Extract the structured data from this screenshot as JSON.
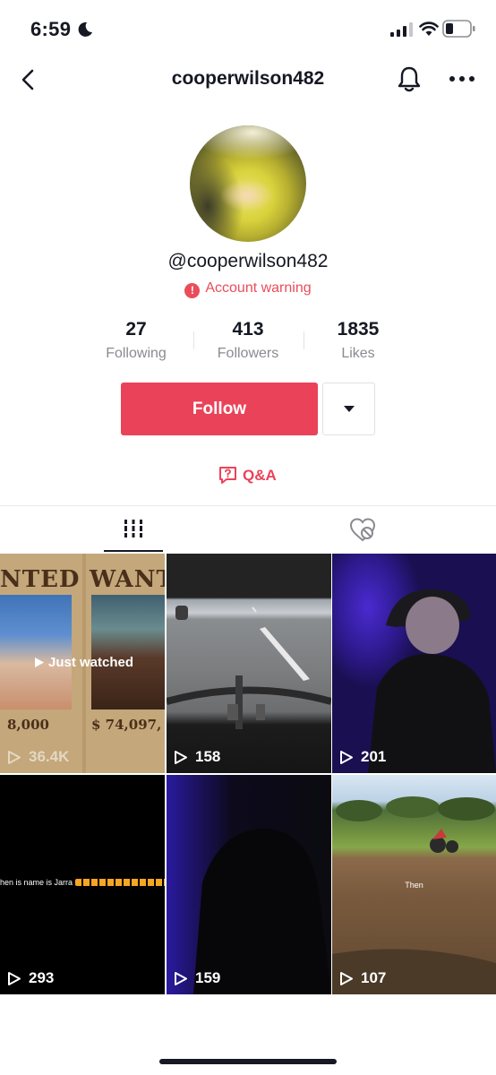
{
  "status_bar": {
    "time": "6:59"
  },
  "nav": {
    "title": "cooperwilson482"
  },
  "profile": {
    "handle": "@cooperwilson482",
    "warning_text": "Account warning",
    "warning_glyph": "!"
  },
  "stats": [
    {
      "value": "27",
      "label": "Following"
    },
    {
      "value": "413",
      "label": "Followers"
    },
    {
      "value": "1835",
      "label": "Likes"
    }
  ],
  "actions": {
    "follow_label": "Follow",
    "qa_label": "Q&A"
  },
  "colors": {
    "accent": "#ea4359",
    "text": "#161823",
    "muted": "#8a8b91"
  },
  "videos": [
    {
      "views": "36.4K",
      "overlay": "Just watched",
      "poster_title_left": "NTED",
      "poster_title_right": "WANT",
      "poster_amount_left": "8,000",
      "poster_amount_right": "74,097,"
    },
    {
      "views": "158"
    },
    {
      "views": "201"
    },
    {
      "views": "293",
      "caption": "hen is name is Jarra"
    },
    {
      "views": "159"
    },
    {
      "views": "107",
      "caption": "Then"
    }
  ],
  "poster_currency": "$"
}
